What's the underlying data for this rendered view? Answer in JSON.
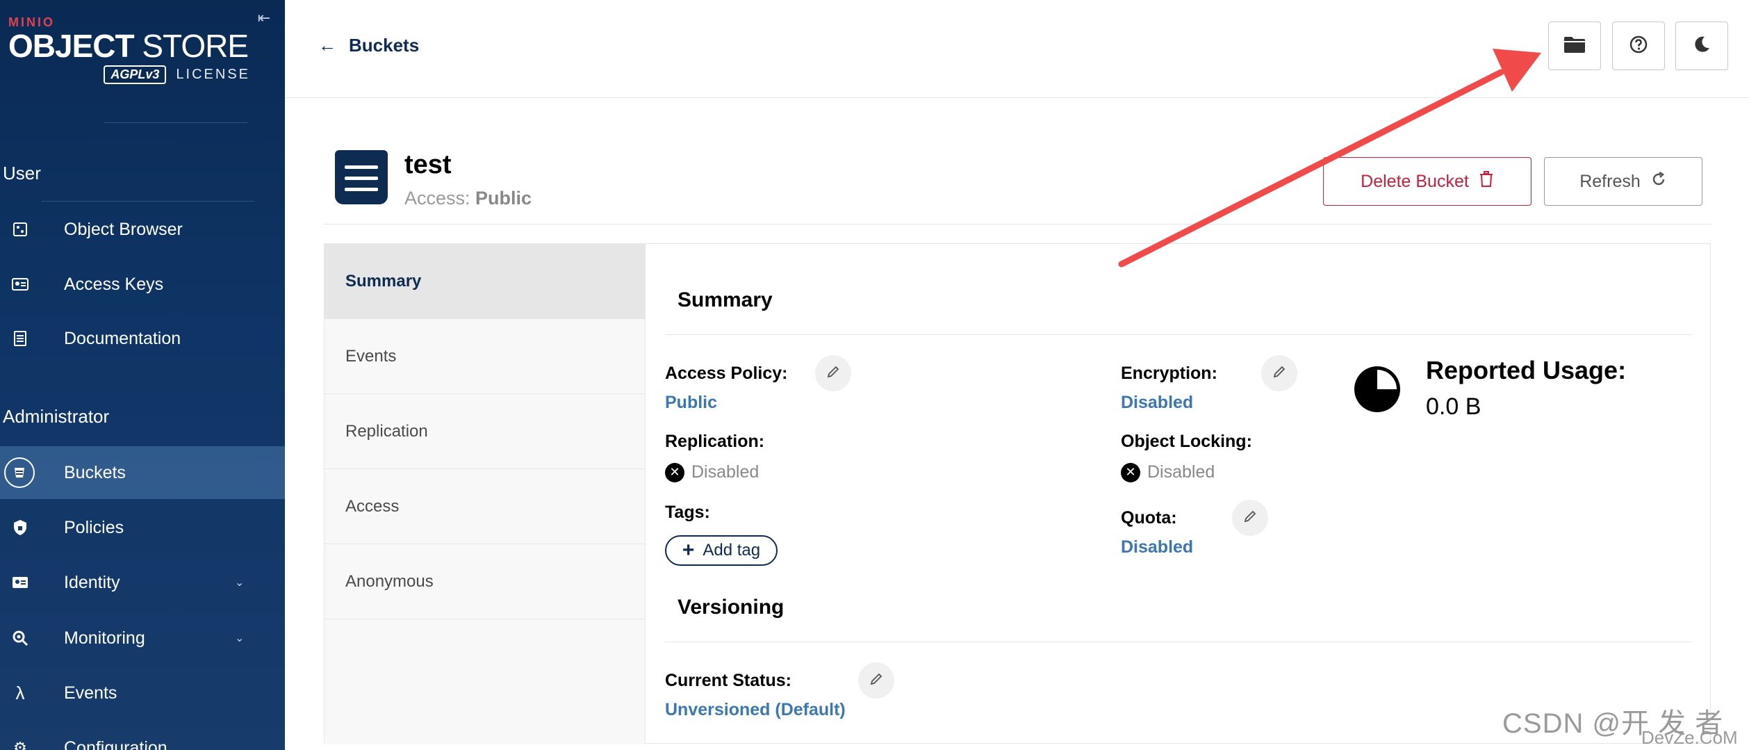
{
  "sidebar": {
    "logo": {
      "brand": "MINIO",
      "product_bold": "OBJECT",
      "product_thin": "STORE",
      "badge": "AGPLv3",
      "license": "LICENSE"
    },
    "sections": {
      "user": "User",
      "administrator": "Administrator"
    },
    "user_items": [
      {
        "label": "Object Browser"
      },
      {
        "label": "Access Keys"
      },
      {
        "label": "Documentation"
      }
    ],
    "admin_items": [
      {
        "label": "Buckets"
      },
      {
        "label": "Policies"
      },
      {
        "label": "Identity"
      },
      {
        "label": "Monitoring"
      },
      {
        "label": "Events"
      },
      {
        "label": "Configuration"
      }
    ]
  },
  "header": {
    "back_label": "Buckets"
  },
  "bucket": {
    "name": "test",
    "access_prefix": "Access:",
    "access_value": "Public",
    "delete_label": "Delete Bucket",
    "refresh_label": "Refresh"
  },
  "tabs": [
    {
      "label": "Summary"
    },
    {
      "label": "Events"
    },
    {
      "label": "Replication"
    },
    {
      "label": "Access"
    },
    {
      "label": "Anonymous"
    }
  ],
  "summary": {
    "title": "Summary",
    "access_policy_label": "Access Policy:",
    "access_policy_value": "Public",
    "replication_label": "Replication:",
    "replication_value": "Disabled",
    "tags_label": "Tags:",
    "add_tag_label": "Add tag",
    "encryption_label": "Encryption:",
    "encryption_value": "Disabled",
    "object_locking_label": "Object Locking:",
    "object_locking_value": "Disabled",
    "quota_label": "Quota:",
    "quota_value": "Disabled",
    "reported_usage_label": "Reported Usage:",
    "reported_usage_value": "0.0 B"
  },
  "versioning": {
    "title": "Versioning",
    "current_status_label": "Current Status:",
    "current_status_value": "Unversioned (Default)"
  },
  "watermark": {
    "line1": "CSDN @开 发 者",
    "line2": "DevZe.CoM"
  },
  "colors": {
    "sidebar_bg": "#0f3566",
    "primary": "#0e2b51",
    "danger": "#c6203a",
    "link": "#3a77b4",
    "arrow": "#f04a4a"
  }
}
